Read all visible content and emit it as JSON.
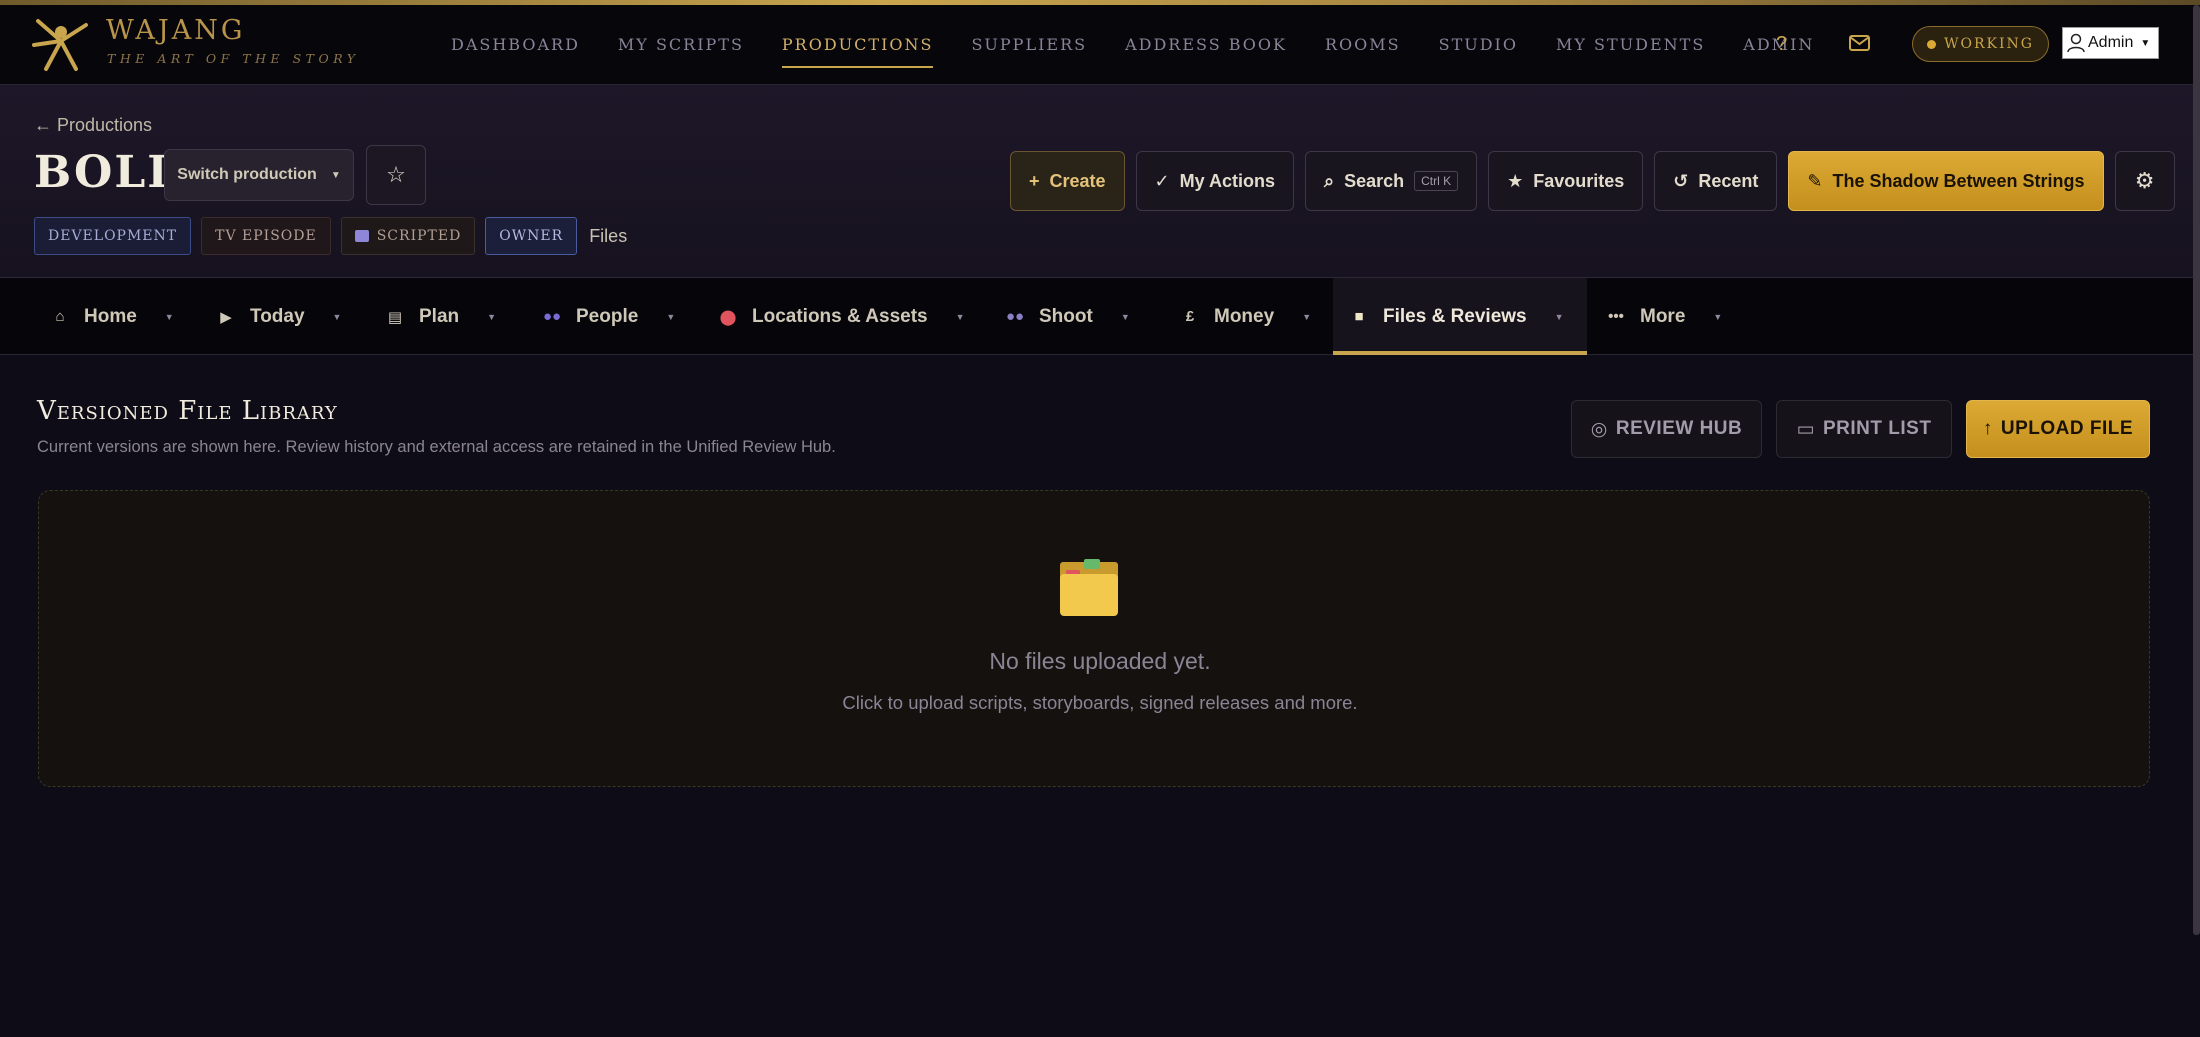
{
  "brand": {
    "name": "WAJANG",
    "tagline": "THE ART OF THE STORY"
  },
  "topnav": {
    "links": [
      "DASHBOARD",
      "MY SCRIPTS",
      "PRODUCTIONS",
      "SUPPLIERS",
      "ADDRESS BOOK",
      "ROOMS",
      "STUDIO",
      "MY STUDENTS",
      "ADMIN"
    ],
    "active": "PRODUCTIONS",
    "help": "?",
    "status": "WORKING",
    "user": "Admin"
  },
  "header": {
    "back": "← Productions",
    "title": "BOLD",
    "switch_label": "Switch production",
    "chips": [
      "DEVELOPMENT",
      "TV EPISODE",
      "SCRIPTED",
      "OWNER"
    ],
    "current_section": "Files",
    "actions": {
      "create": "Create",
      "my_actions": "My Actions",
      "search": "Search",
      "search_kbd": "Ctrl K",
      "favourites": "Favourites",
      "recent": "Recent",
      "story": "The Shadow Between Strings"
    }
  },
  "tabs": [
    {
      "label": "Home",
      "icon": "home-icon"
    },
    {
      "label": "Today",
      "icon": "play-icon"
    },
    {
      "label": "Plan",
      "icon": "clipboard-icon"
    },
    {
      "label": "People",
      "icon": "people-icon"
    },
    {
      "label": "Locations & Assets",
      "icon": "pin-icon"
    },
    {
      "label": "Shoot",
      "icon": "camera-crew-icon"
    },
    {
      "label": "Money",
      "icon": "pound-icon"
    },
    {
      "label": "Files & Reviews",
      "icon": "folder-icon"
    },
    {
      "label": "More",
      "icon": "dots-icon"
    }
  ],
  "active_tab": "Files & Reviews",
  "main": {
    "title": "Versioned File Library",
    "subtitle": "Current versions are shown here. Review history and external access are retained in the Unified Review Hub.",
    "review_hub": "REVIEW HUB",
    "print_list": "PRINT LIST",
    "upload": "UPLOAD FILE",
    "empty_title": "No files uploaded yet.",
    "empty_subtitle": "Click to upload scripts, storyboards, signed releases and more."
  },
  "colors": {
    "accent": "#c9a54e",
    "background": "#0e0c16",
    "button_gold": "#d4a02a"
  }
}
